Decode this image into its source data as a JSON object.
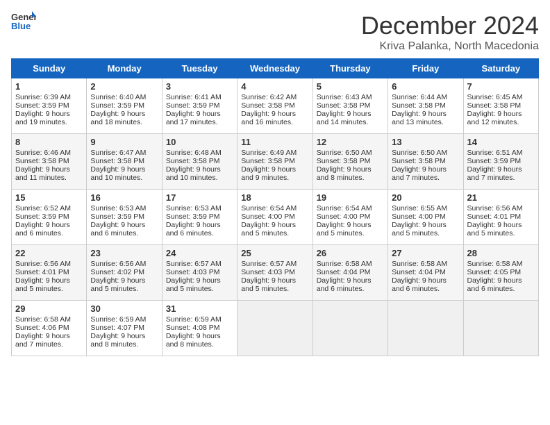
{
  "header": {
    "logo_general": "General",
    "logo_blue": "Blue",
    "month": "December 2024",
    "location": "Kriva Palanka, North Macedonia"
  },
  "days_of_week": [
    "Sunday",
    "Monday",
    "Tuesday",
    "Wednesday",
    "Thursday",
    "Friday",
    "Saturday"
  ],
  "weeks": [
    [
      {
        "day": "1",
        "lines": [
          "Sunrise: 6:39 AM",
          "Sunset: 3:59 PM",
          "Daylight: 9 hours",
          "and 19 minutes."
        ]
      },
      {
        "day": "2",
        "lines": [
          "Sunrise: 6:40 AM",
          "Sunset: 3:59 PM",
          "Daylight: 9 hours",
          "and 18 minutes."
        ]
      },
      {
        "day": "3",
        "lines": [
          "Sunrise: 6:41 AM",
          "Sunset: 3:59 PM",
          "Daylight: 9 hours",
          "and 17 minutes."
        ]
      },
      {
        "day": "4",
        "lines": [
          "Sunrise: 6:42 AM",
          "Sunset: 3:58 PM",
          "Daylight: 9 hours",
          "and 16 minutes."
        ]
      },
      {
        "day": "5",
        "lines": [
          "Sunrise: 6:43 AM",
          "Sunset: 3:58 PM",
          "Daylight: 9 hours",
          "and 14 minutes."
        ]
      },
      {
        "day": "6",
        "lines": [
          "Sunrise: 6:44 AM",
          "Sunset: 3:58 PM",
          "Daylight: 9 hours",
          "and 13 minutes."
        ]
      },
      {
        "day": "7",
        "lines": [
          "Sunrise: 6:45 AM",
          "Sunset: 3:58 PM",
          "Daylight: 9 hours",
          "and 12 minutes."
        ]
      }
    ],
    [
      {
        "day": "8",
        "lines": [
          "Sunrise: 6:46 AM",
          "Sunset: 3:58 PM",
          "Daylight: 9 hours",
          "and 11 minutes."
        ]
      },
      {
        "day": "9",
        "lines": [
          "Sunrise: 6:47 AM",
          "Sunset: 3:58 PM",
          "Daylight: 9 hours",
          "and 10 minutes."
        ]
      },
      {
        "day": "10",
        "lines": [
          "Sunrise: 6:48 AM",
          "Sunset: 3:58 PM",
          "Daylight: 9 hours",
          "and 10 minutes."
        ]
      },
      {
        "day": "11",
        "lines": [
          "Sunrise: 6:49 AM",
          "Sunset: 3:58 PM",
          "Daylight: 9 hours",
          "and 9 minutes."
        ]
      },
      {
        "day": "12",
        "lines": [
          "Sunrise: 6:50 AM",
          "Sunset: 3:58 PM",
          "Daylight: 9 hours",
          "and 8 minutes."
        ]
      },
      {
        "day": "13",
        "lines": [
          "Sunrise: 6:50 AM",
          "Sunset: 3:58 PM",
          "Daylight: 9 hours",
          "and 7 minutes."
        ]
      },
      {
        "day": "14",
        "lines": [
          "Sunrise: 6:51 AM",
          "Sunset: 3:59 PM",
          "Daylight: 9 hours",
          "and 7 minutes."
        ]
      }
    ],
    [
      {
        "day": "15",
        "lines": [
          "Sunrise: 6:52 AM",
          "Sunset: 3:59 PM",
          "Daylight: 9 hours",
          "and 6 minutes."
        ]
      },
      {
        "day": "16",
        "lines": [
          "Sunrise: 6:53 AM",
          "Sunset: 3:59 PM",
          "Daylight: 9 hours",
          "and 6 minutes."
        ]
      },
      {
        "day": "17",
        "lines": [
          "Sunrise: 6:53 AM",
          "Sunset: 3:59 PM",
          "Daylight: 9 hours",
          "and 6 minutes."
        ]
      },
      {
        "day": "18",
        "lines": [
          "Sunrise: 6:54 AM",
          "Sunset: 4:00 PM",
          "Daylight: 9 hours",
          "and 5 minutes."
        ]
      },
      {
        "day": "19",
        "lines": [
          "Sunrise: 6:54 AM",
          "Sunset: 4:00 PM",
          "Daylight: 9 hours",
          "and 5 minutes."
        ]
      },
      {
        "day": "20",
        "lines": [
          "Sunrise: 6:55 AM",
          "Sunset: 4:00 PM",
          "Daylight: 9 hours",
          "and 5 minutes."
        ]
      },
      {
        "day": "21",
        "lines": [
          "Sunrise: 6:56 AM",
          "Sunset: 4:01 PM",
          "Daylight: 9 hours",
          "and 5 minutes."
        ]
      }
    ],
    [
      {
        "day": "22",
        "lines": [
          "Sunrise: 6:56 AM",
          "Sunset: 4:01 PM",
          "Daylight: 9 hours",
          "and 5 minutes."
        ]
      },
      {
        "day": "23",
        "lines": [
          "Sunrise: 6:56 AM",
          "Sunset: 4:02 PM",
          "Daylight: 9 hours",
          "and 5 minutes."
        ]
      },
      {
        "day": "24",
        "lines": [
          "Sunrise: 6:57 AM",
          "Sunset: 4:03 PM",
          "Daylight: 9 hours",
          "and 5 minutes."
        ]
      },
      {
        "day": "25",
        "lines": [
          "Sunrise: 6:57 AM",
          "Sunset: 4:03 PM",
          "Daylight: 9 hours",
          "and 5 minutes."
        ]
      },
      {
        "day": "26",
        "lines": [
          "Sunrise: 6:58 AM",
          "Sunset: 4:04 PM",
          "Daylight: 9 hours",
          "and 6 minutes."
        ]
      },
      {
        "day": "27",
        "lines": [
          "Sunrise: 6:58 AM",
          "Sunset: 4:04 PM",
          "Daylight: 9 hours",
          "and 6 minutes."
        ]
      },
      {
        "day": "28",
        "lines": [
          "Sunrise: 6:58 AM",
          "Sunset: 4:05 PM",
          "Daylight: 9 hours",
          "and 6 minutes."
        ]
      }
    ],
    [
      {
        "day": "29",
        "lines": [
          "Sunrise: 6:58 AM",
          "Sunset: 4:06 PM",
          "Daylight: 9 hours",
          "and 7 minutes."
        ]
      },
      {
        "day": "30",
        "lines": [
          "Sunrise: 6:59 AM",
          "Sunset: 4:07 PM",
          "Daylight: 9 hours",
          "and 8 minutes."
        ]
      },
      {
        "day": "31",
        "lines": [
          "Sunrise: 6:59 AM",
          "Sunset: 4:08 PM",
          "Daylight: 9 hours",
          "and 8 minutes."
        ]
      },
      null,
      null,
      null,
      null
    ]
  ]
}
